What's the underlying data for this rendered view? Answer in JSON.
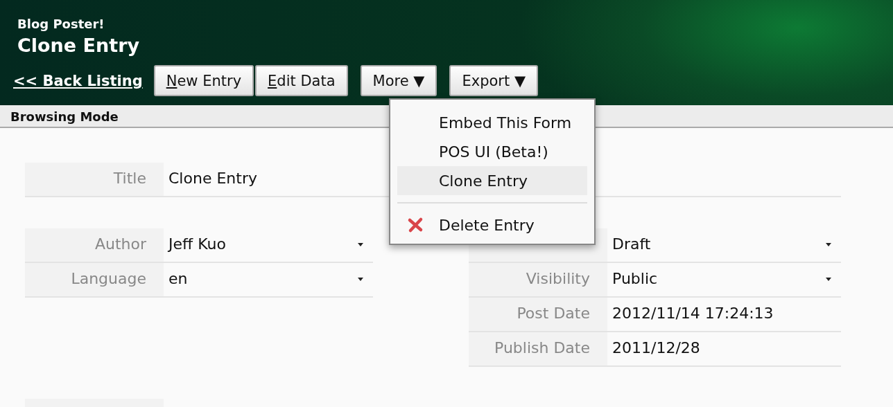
{
  "header": {
    "app_name": "Blog Poster!",
    "page_title": "Clone Entry"
  },
  "toolbar": {
    "back_link": "<< Back Listing",
    "buttons": [
      {
        "label": "New Entry",
        "kind": "button",
        "mnemonic_first": true
      },
      {
        "label": "Edit Data",
        "kind": "button",
        "mnemonic_first": true
      },
      {
        "label": "More",
        "kind": "menu",
        "caret": "▼"
      },
      {
        "label": "Export",
        "kind": "menu",
        "caret": "▼"
      }
    ]
  },
  "mode_bar": "Browsing Mode",
  "menu": {
    "items": [
      {
        "kind": "item",
        "label": "Embed This Form",
        "selected": false
      },
      {
        "kind": "item",
        "label": "POS UI (Beta!)",
        "selected": false
      },
      {
        "kind": "item",
        "label": "Clone Entry",
        "selected": true
      },
      {
        "kind": "separator"
      },
      {
        "kind": "delete",
        "label": "Delete Entry",
        "selected": false
      }
    ]
  },
  "form": {
    "title_row": {
      "label": "Title",
      "value": "Clone Entry"
    },
    "left_rows": [
      {
        "label": "Author",
        "value": "Jeff Kuo",
        "kind": "select"
      },
      {
        "label": "Language",
        "value": "en",
        "kind": "select"
      }
    ],
    "right_rows": [
      {
        "value": "Draft",
        "kind": "select"
      },
      {
        "label": "Visibility",
        "value": "Public",
        "kind": "select"
      },
      {
        "label": "Post Date",
        "value": "2012/11/14 17:24:13",
        "kind": "text"
      },
      {
        "label": "Publish Date",
        "value": "2011/12/28",
        "kind": "text"
      }
    ]
  }
}
